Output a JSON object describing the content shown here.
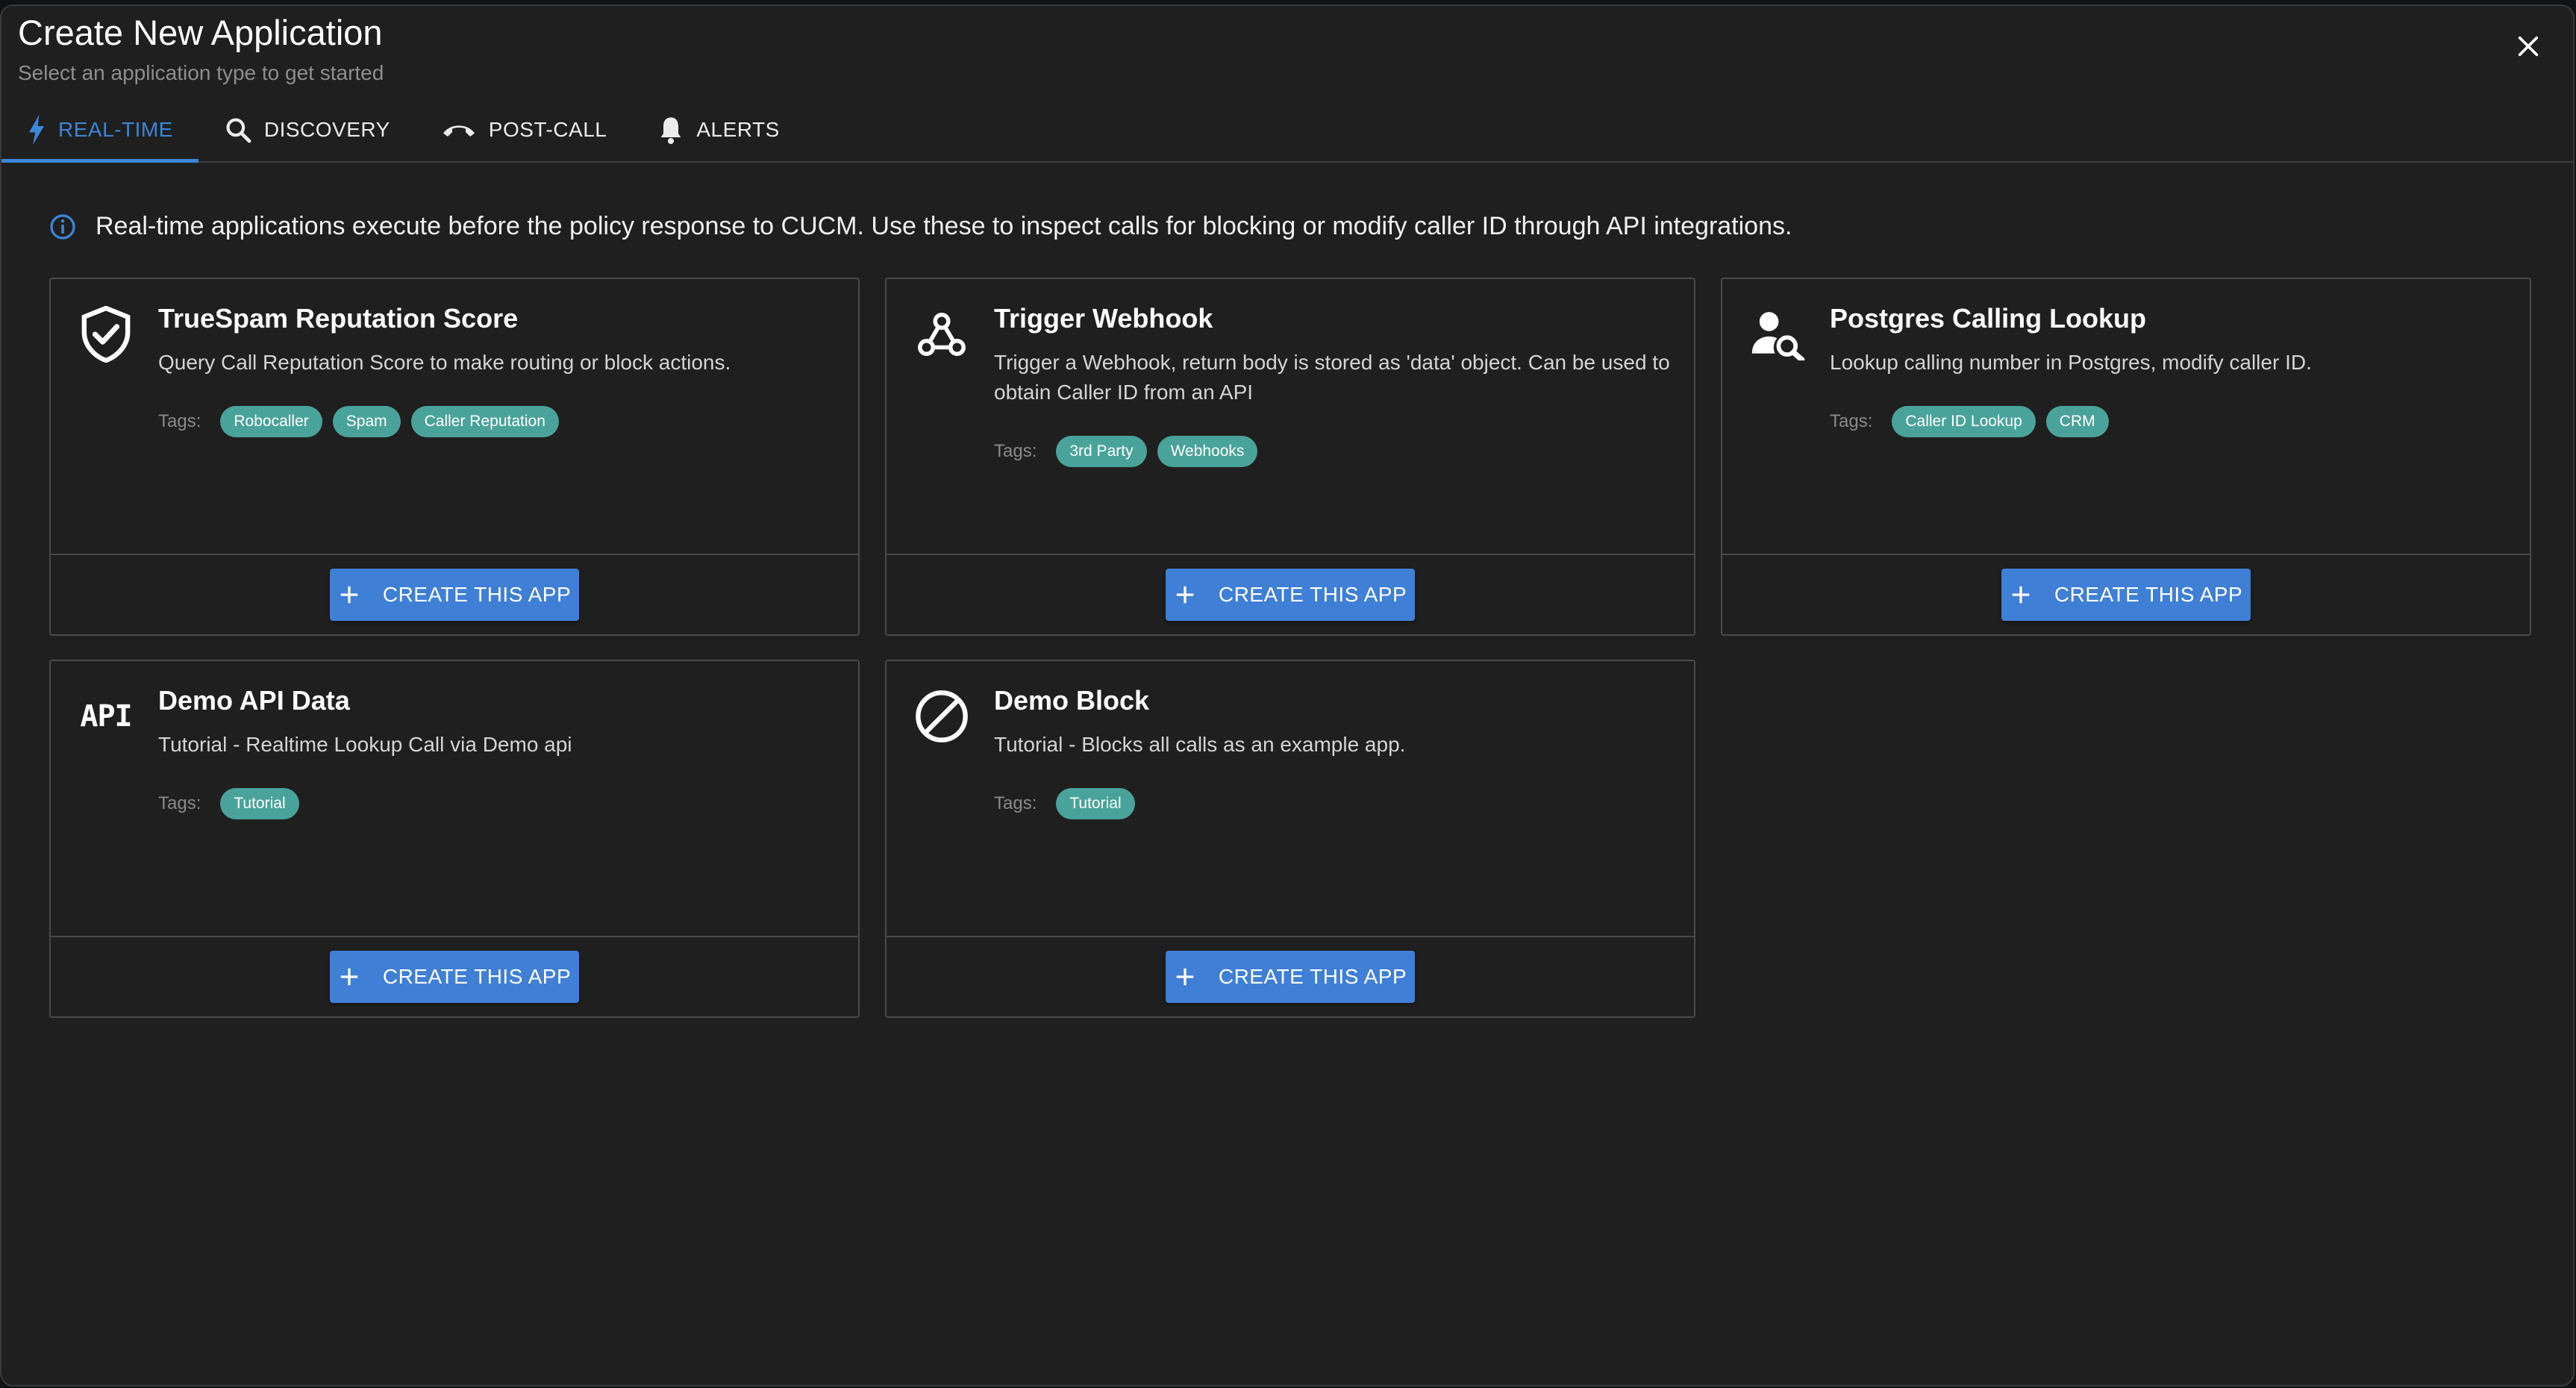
{
  "dialog": {
    "title": "Create New Application",
    "subtitle": "Select an application type to get started"
  },
  "tabs": [
    {
      "label": "REAL-TIME",
      "icon": "bolt-icon",
      "active": true
    },
    {
      "label": "DISCOVERY",
      "icon": "search-icon",
      "active": false
    },
    {
      "label": "POST-CALL",
      "icon": "call-end-icon",
      "active": false
    },
    {
      "label": "ALERTS",
      "icon": "bell-icon",
      "active": false
    }
  ],
  "info": {
    "text": "Real-time applications execute before the policy response to CUCM. Use these to inspect calls for blocking or modify caller ID through API integrations."
  },
  "tags_label": "Tags:",
  "create_label": "CREATE THIS APP",
  "cards": [
    {
      "title": "TrueSpam Reputation Score",
      "description": "Query Call Reputation Score to make routing or block actions.",
      "icon": "shield-check-icon",
      "tags": [
        "Robocaller",
        "Spam",
        "Caller Reputation"
      ]
    },
    {
      "title": "Trigger Webhook",
      "description": "Trigger a Webhook, return body is stored as 'data' object. Can be used to obtain Caller ID from an API",
      "icon": "webhook-icon",
      "tags": [
        "3rd Party",
        "Webhooks"
      ]
    },
    {
      "title": "Postgres Calling Lookup",
      "description": "Lookup calling number in Postgres, modify caller ID.",
      "icon": "person-search-icon",
      "tags": [
        "Caller ID Lookup",
        "CRM"
      ]
    },
    {
      "title": "Demo API Data",
      "description": "Tutorial - Realtime Lookup Call via Demo api",
      "icon": "api-icon",
      "icon_text": "API",
      "tags": [
        "Tutorial"
      ]
    },
    {
      "title": "Demo Block",
      "description": "Tutorial - Blocks all calls as an example app.",
      "icon": "block-icon",
      "tags": [
        "Tutorial"
      ]
    }
  ],
  "colors": {
    "accent": "#3b86d8",
    "button": "#3f7fd6",
    "chip": "#4aa39a",
    "background": "#1f1f1f"
  }
}
